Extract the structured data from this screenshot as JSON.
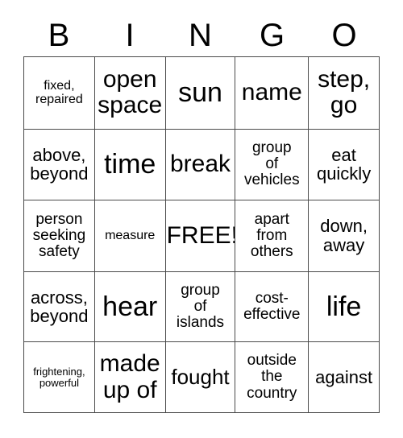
{
  "card": {
    "title_letters": [
      "B",
      "I",
      "N",
      "G",
      "O"
    ],
    "free_space_label": "FREE!",
    "grid_line_color": "#4a4a4a",
    "text_color": "#000000",
    "background_color": "#ffffff",
    "rows": [
      [
        {
          "text": "fixed,\nrepaired",
          "size": "fs-xs"
        },
        {
          "text": "open\nspace",
          "size": "fs-xl"
        },
        {
          "text": "sun",
          "size": "fs-xxl"
        },
        {
          "text": "name",
          "size": "fs-xl"
        },
        {
          "text": "step,\ngo",
          "size": "fs-xl"
        }
      ],
      [
        {
          "text": "above,\nbeyond",
          "size": "fs-md"
        },
        {
          "text": "time",
          "size": "fs-xxl"
        },
        {
          "text": "break",
          "size": "fs-xl"
        },
        {
          "text": "group\nof\nvehicles",
          "size": "fs-sm"
        },
        {
          "text": "eat\nquickly",
          "size": "fs-md"
        }
      ],
      [
        {
          "text": "person\nseeking\nsafety",
          "size": "fs-sm"
        },
        {
          "text": "measure",
          "size": "fs-xs"
        },
        {
          "text": "FREE!",
          "size": "fs-xl"
        },
        {
          "text": "apart\nfrom\nothers",
          "size": "fs-sm"
        },
        {
          "text": "down,\naway",
          "size": "fs-md"
        }
      ],
      [
        {
          "text": "across,\nbeyond",
          "size": "fs-md"
        },
        {
          "text": "hear",
          "size": "fs-xxl"
        },
        {
          "text": "group\nof\nislands",
          "size": "fs-sm"
        },
        {
          "text": "cost-\neffective",
          "size": "fs-sm"
        },
        {
          "text": "life",
          "size": "fs-xxl"
        }
      ],
      [
        {
          "text": "frightening,\npowerful",
          "size": "fs-xxs"
        },
        {
          "text": "made\nup of",
          "size": "fs-xl"
        },
        {
          "text": "fought",
          "size": "fs-lg"
        },
        {
          "text": "outside\nthe\ncountry",
          "size": "fs-sm"
        },
        {
          "text": "against",
          "size": "fs-md"
        }
      ]
    ]
  }
}
